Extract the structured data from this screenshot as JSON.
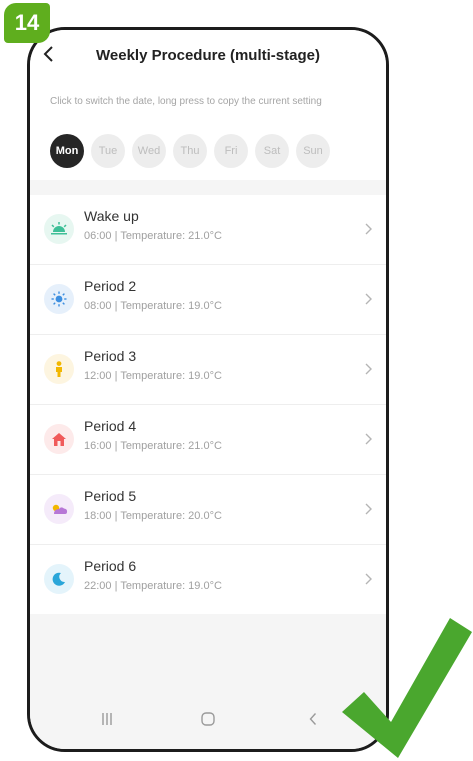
{
  "step_badge": "14",
  "header": {
    "title": "Weekly Procedure (multi-stage)",
    "back_icon": "back-arrow-icon"
  },
  "hint": "Click to switch the date, long press to copy the current setting",
  "days": [
    "Mon",
    "Tue",
    "Wed",
    "Thu",
    "Fri",
    "Sat",
    "Sun"
  ],
  "selected_day": "Mon",
  "periods": [
    {
      "name": "Wake up",
      "time": "06:00",
      "temperature": "Temperature: 21.0°C",
      "icon": "sunrise-icon",
      "color": "#3dbf97"
    },
    {
      "name": "Period 2",
      "time": "08:00",
      "temperature": "Temperature: 19.0°C",
      "icon": "sun-icon",
      "color": "#3d8fe0"
    },
    {
      "name": "Period 3",
      "time": "12:00",
      "temperature": "Temperature: 19.0°C",
      "icon": "person-icon",
      "color": "#f2b700"
    },
    {
      "name": "Period 4",
      "time": "16:00",
      "temperature": "Temperature: 21.0°C",
      "icon": "home-icon",
      "color": "#f05a5a"
    },
    {
      "name": "Period 5",
      "time": "18:00",
      "temperature": "Temperature: 20.0°C",
      "icon": "sunset-icon",
      "color": "#b777d6"
    },
    {
      "name": "Period 6",
      "time": "22:00",
      "temperature": "Temperature: 19.0°C",
      "icon": "moon-icon",
      "color": "#2aa6d9"
    }
  ],
  "colors": {
    "badge": "#5fae1e",
    "checkmark": "#4aa72e",
    "active_day": "#262626"
  }
}
